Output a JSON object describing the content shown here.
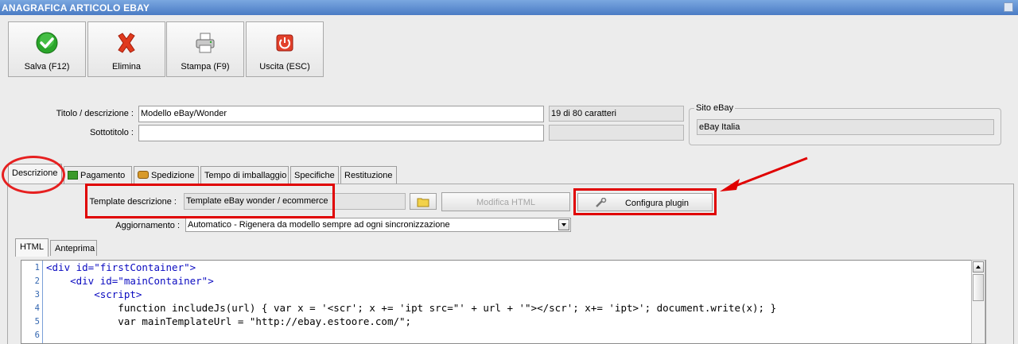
{
  "window": {
    "title": "ANAGRAFICA ARTICOLO EBAY"
  },
  "toolbar": {
    "save_label": "Salva (F12)",
    "delete_label": "Elimina",
    "print_label": "Stampa (F9)",
    "exit_label": "Uscita (ESC)"
  },
  "form": {
    "title_label": "Titolo / descrizione :",
    "title_value": "Modello eBay/Wonder",
    "char_count": "19 di 80 caratteri",
    "subtitle_label": "Sottotitolo :",
    "subtitle_value": "",
    "site_group_label": "Sito eBay",
    "site_value": "eBay Italia"
  },
  "tabs": [
    {
      "label": "Descrizione",
      "active": true
    },
    {
      "label": "Pagamento"
    },
    {
      "label": "Spedizione"
    },
    {
      "label": "Tempo di imballaggio"
    },
    {
      "label": "Specifiche"
    },
    {
      "label": "Restituzione"
    }
  ],
  "description": {
    "template_label": "Template descrizione :",
    "template_value": "Template eBay wonder / ecommerce",
    "edit_html_label": "Modifica HTML",
    "configure_plugin_label": "Configura plugin",
    "update_label": "Aggiornamento :",
    "update_value": "Automatico - Rigenera da modello sempre ad ogni sincronizzazione"
  },
  "subtabs": [
    {
      "label": "HTML",
      "active": true
    },
    {
      "label": "Anteprima"
    }
  ],
  "editor": {
    "line_numbers": [
      "1",
      "2",
      "3",
      "4",
      "5",
      "6"
    ],
    "lines": [
      "<div id=\"firstContainer\">",
      "    <div id=\"mainContainer\">",
      "        <script>",
      "            function includeJs(url) { var x = '<scr'; x += 'ipt src=\"' + url + '\"></scr'; x+= 'ipt>'; document.write(x); }",
      "            var mainTemplateUrl = \"http://ebay.estoore.com/\";",
      ""
    ]
  },
  "colors": {
    "annotation_red": "#e00000",
    "titlebar": "#4a7bc4"
  }
}
